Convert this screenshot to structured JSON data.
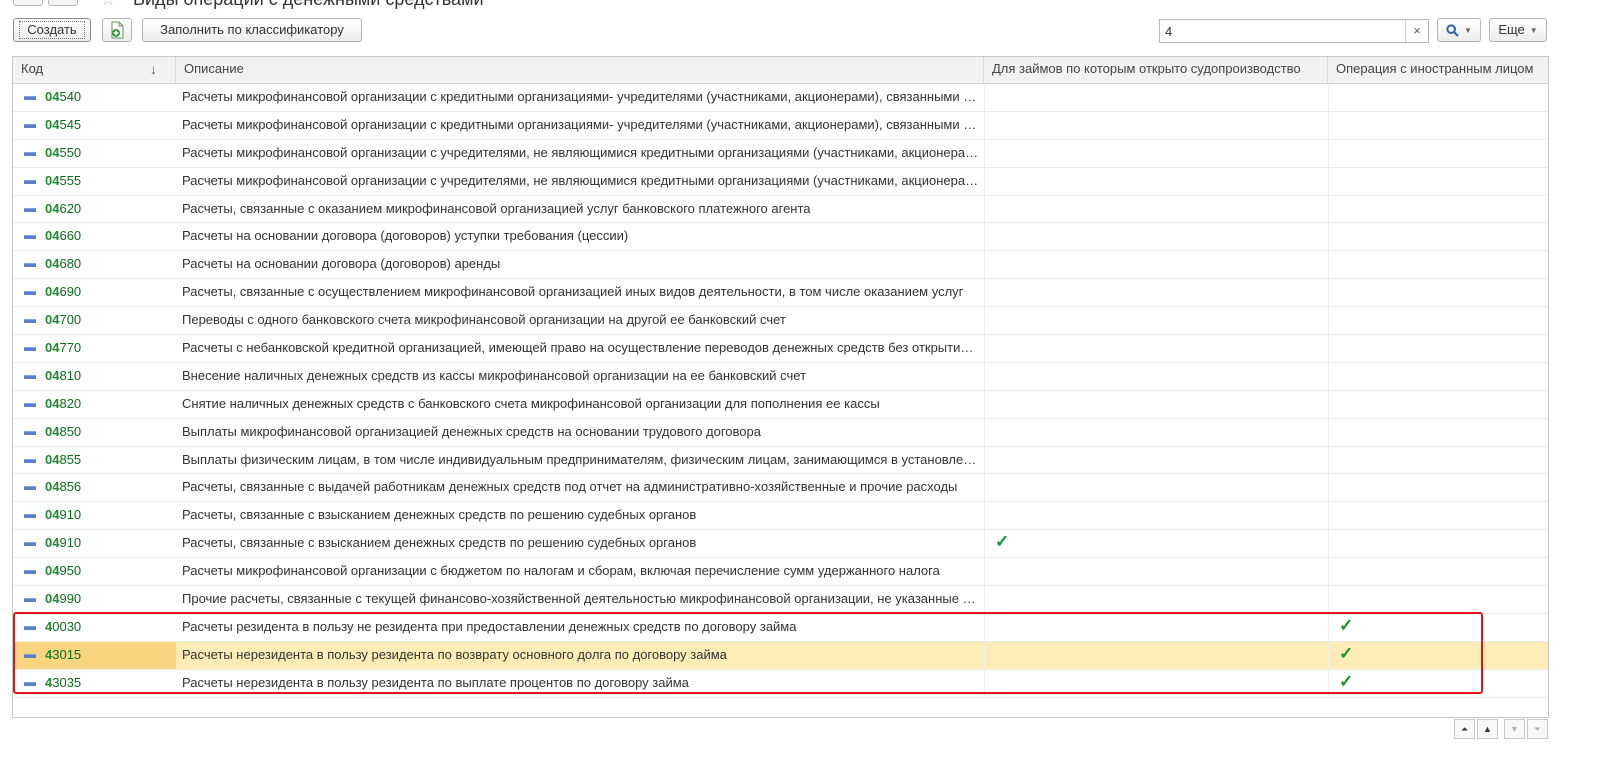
{
  "window": {
    "title": "Виды операций с денежными средствами"
  },
  "toolbar": {
    "create_label": "Создать",
    "add_icon": "add-document-icon",
    "fill_label": "Заполнить по классификатору",
    "search_value": "4",
    "search_clear": "×",
    "find_icon": "magnifier-icon",
    "more_label": "Еще"
  },
  "table": {
    "columns": {
      "code": "Код",
      "description": "Описание",
      "court": "Для займов по которым открыто судопроизводство",
      "foreign": "Операция с иностранным лицом"
    },
    "sort_indicator": "↓",
    "rows": [
      {
        "code_hl": "04",
        "code_rest": "540",
        "desc": "Расчеты микрофинансовой организации с кредитными организациями- учредителями (участниками, акционерами), связанными с привлечением денежных средств",
        "court": "",
        "foreign": ""
      },
      {
        "code_hl": "04",
        "code_rest": "545",
        "desc": "Расчеты микрофинансовой организации с кредитными организациями- учредителями (участниками, акционерами), связанными с возвратом денежных средств",
        "court": "",
        "foreign": ""
      },
      {
        "code_hl": "04",
        "code_rest": "550",
        "desc": "Расчеты микрофинансовой организации с учредителями, не являющимися кредитными организациями (участниками, акционерами)",
        "court": "",
        "foreign": ""
      },
      {
        "code_hl": "04",
        "code_rest": "555",
        "desc": "Расчеты микрофинансовой организации с учредителями, не являющимися кредитными организациями (участниками, акционерами)",
        "court": "",
        "foreign": ""
      },
      {
        "code_hl": "04",
        "code_rest": "620",
        "desc": "Расчеты, связанные с оказанием микрофинансовой организацией услуг банковского платежного агента",
        "court": "",
        "foreign": ""
      },
      {
        "code_hl": "04",
        "code_rest": "660",
        "desc": "Расчеты на основании договора (договоров) уступки требования (цессии)",
        "court": "",
        "foreign": ""
      },
      {
        "code_hl": "04",
        "code_rest": "680",
        "desc": "Расчеты на основании договора (договоров) аренды",
        "court": "",
        "foreign": ""
      },
      {
        "code_hl": "04",
        "code_rest": "690",
        "desc": "Расчеты, связанные с осуществлением микрофинансовой организацией иных видов деятельности, в том числе оказанием услуг",
        "court": "",
        "foreign": ""
      },
      {
        "code_hl": "04",
        "code_rest": "700",
        "desc": "Переводы с одного банковского счета микрофинансовой организации на другой ее банковский счет",
        "court": "",
        "foreign": ""
      },
      {
        "code_hl": "04",
        "code_rest": "770",
        "desc": "Расчеты с небанковской кредитной организацией, имеющей право на осуществление переводов денежных средств без открытия счетов",
        "court": "",
        "foreign": ""
      },
      {
        "code_hl": "04",
        "code_rest": "810",
        "desc": "Внесение наличных денежных средств из кассы микрофинансовой организации на ее банковский счет",
        "court": "",
        "foreign": ""
      },
      {
        "code_hl": "04",
        "code_rest": "820",
        "desc": "Снятие наличных денежных средств с банковского счета микрофинансовой организации для пополнения ее кассы",
        "court": "",
        "foreign": ""
      },
      {
        "code_hl": "04",
        "code_rest": "850",
        "desc": "Выплаты микрофинансовой организацией денежных средств на основании трудового договора",
        "court": "",
        "foreign": ""
      },
      {
        "code_hl": "04",
        "code_rest": "855",
        "desc": "Выплаты физическим лицам, в том числе индивидуальным предпринимателям, физическим лицам, занимающимся в установленном порядке частной практикой",
        "court": "",
        "foreign": ""
      },
      {
        "code_hl": "04",
        "code_rest": "856",
        "desc": "Расчеты, связанные с выдачей работникам денежных средств под отчет на административно-хозяйственные и прочие расходы",
        "court": "",
        "foreign": ""
      },
      {
        "code_hl": "04",
        "code_rest": "910",
        "desc": "Расчеты, связанные с взысканием денежных средств по решению судебных органов",
        "court": "",
        "foreign": ""
      },
      {
        "code_hl": "04",
        "code_rest": "910",
        "desc": "Расчеты, связанные с взысканием денежных средств по решению судебных органов",
        "court": "✓",
        "foreign": ""
      },
      {
        "code_hl": "04",
        "code_rest": "950",
        "desc": "Расчеты микрофинансовой организации с бюджетом по налогам и сборам, включая перечисление сумм удержанного налога",
        "court": "",
        "foreign": ""
      },
      {
        "code_hl": "04",
        "code_rest": "990",
        "desc": "Прочие расчеты, связанные с текущей финансово-хозяйственной деятельностью микрофинансовой организации, не указанные выше",
        "court": "",
        "foreign": ""
      },
      {
        "code_hl": "4",
        "code_rest": "0030",
        "desc": "Расчеты резидента в пользу не резидента при предоставлении денежных средств по договору займа",
        "court": "",
        "foreign": "✓"
      },
      {
        "code_hl": "4",
        "code_rest": "3015",
        "desc": "Расчеты нерезидента в пользу резидента по возврату основного долга по договору займа",
        "court": "",
        "foreign": "✓",
        "selected": true
      },
      {
        "code_hl": "4",
        "code_rest": "3035",
        "desc": "Расчеты нерезидента в пользу резидента по выплате процентов по договору займа",
        "court": "",
        "foreign": "✓"
      }
    ]
  },
  "pager": {
    "first": "▲̲",
    "up": "▲",
    "down": "▼",
    "last": "▼̲"
  },
  "colors": {
    "selected_row": "#fbedb5",
    "selected_cell": "#fad581",
    "highlight_frame": "#e0141c",
    "check": "#17903a",
    "code_text": "#0d6b1e"
  }
}
